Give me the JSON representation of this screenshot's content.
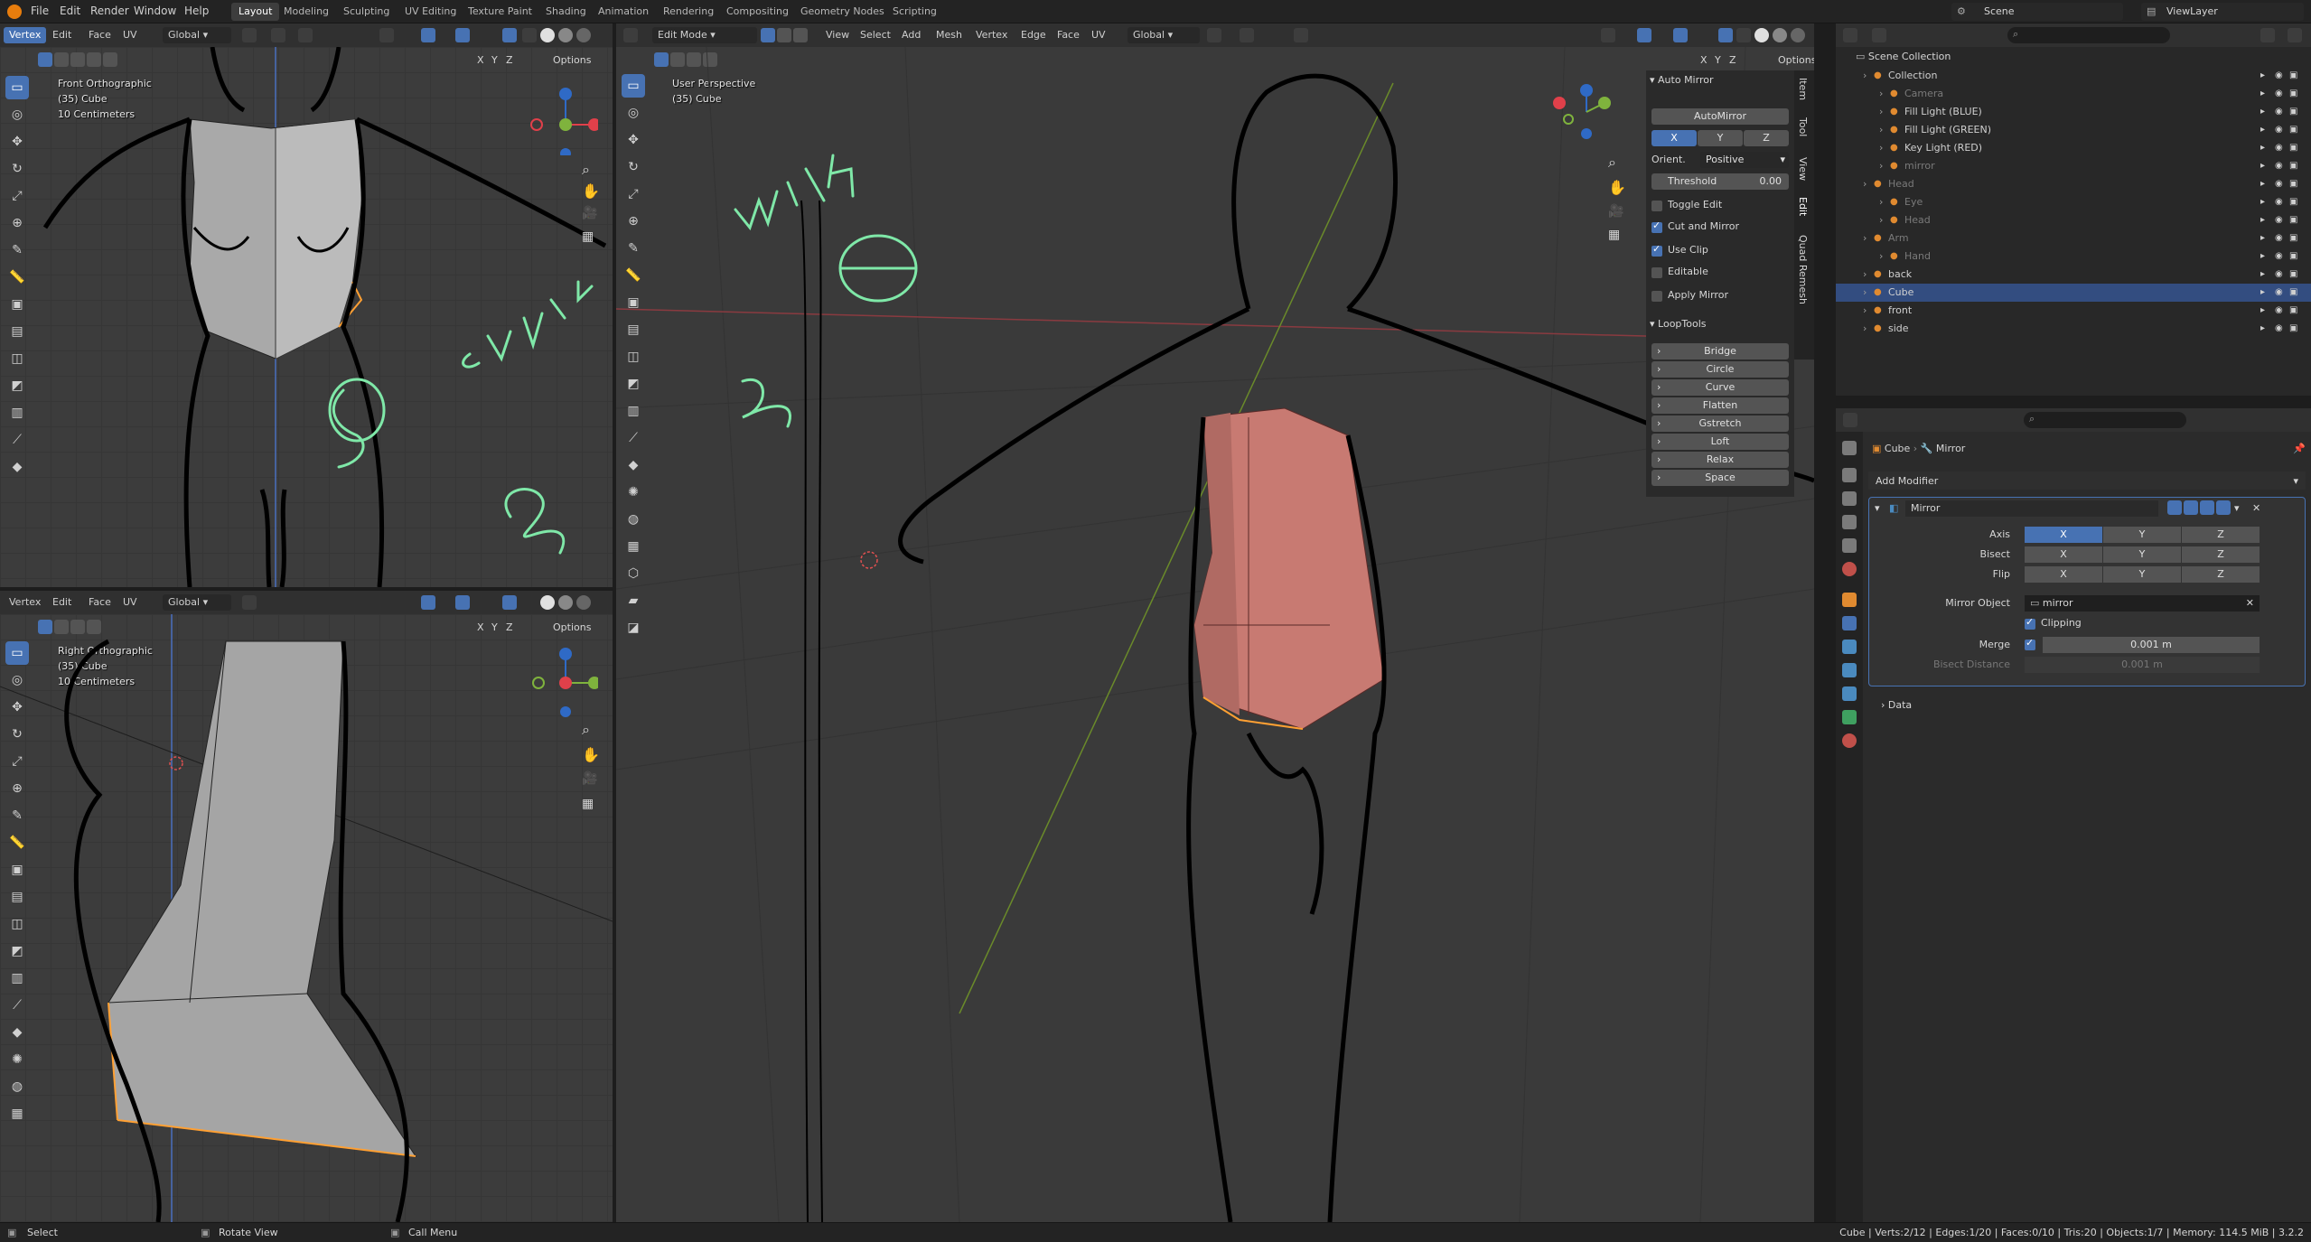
{
  "menubar": {
    "menus": [
      "File",
      "Edit",
      "Render",
      "Window",
      "Help"
    ],
    "workspaces": [
      "Layout",
      "Modeling",
      "Sculpting",
      "UV Editing",
      "Texture Paint",
      "Shading",
      "Animation",
      "Rendering",
      "Compositing",
      "Geometry Nodes",
      "Scripting"
    ],
    "active_workspace": "Layout",
    "scene_label": "Scene",
    "viewlayer_label": "ViewLayer"
  },
  "front_viewport": {
    "header": {
      "select_mode": "Vertex",
      "menus": [
        "Edit",
        "Face",
        "UV"
      ],
      "orientation": "Global",
      "options": "Options",
      "axes": [
        "X",
        "Y",
        "Z"
      ]
    },
    "overlay_title": "Front Orthographic",
    "overlay_object": "(35) Cube",
    "overlay_scale": "10 Centimeters"
  },
  "right_viewport": {
    "header": {
      "select_mode": "Vertex",
      "menus": [
        "Edit",
        "Face",
        "UV"
      ],
      "orientation": "Global",
      "options": "Options",
      "axes": [
        "X",
        "Y",
        "Z"
      ]
    },
    "overlay_title": "Right Orthographic",
    "overlay_object": "(35) Cube",
    "overlay_scale": "10 Centimeters"
  },
  "persp_viewport": {
    "header": {
      "mode": "Edit Mode",
      "menus": [
        "View",
        "Select",
        "Add",
        "Mesh",
        "Vertex",
        "Edge",
        "Face",
        "UV"
      ],
      "orientation": "Global",
      "options": "Options",
      "axes": [
        "X",
        "Y",
        "Z"
      ]
    },
    "overlay_title": "User Perspective",
    "overlay_object": "(35) Cube"
  },
  "handwriting": [
    "Corrects",
    "with",
    "Z",
    "S"
  ],
  "npanel": {
    "tabs": [
      "Item",
      "Tool",
      "View",
      "Edit",
      "Quad Remesh"
    ],
    "auto_mirror": {
      "title": "Auto Mirror",
      "button": "AutoMirror",
      "axes": [
        "X",
        "Y",
        "Z"
      ],
      "orient_label": "Orient.",
      "orient_value": "Positive",
      "threshold_label": "Threshold",
      "threshold_value": "0.00",
      "toggle_edit": "Toggle Edit",
      "cut_and_mirror": "Cut and Mirror",
      "use_clip": "Use Clip",
      "editable": "Editable",
      "apply_mirror": "Apply Mirror"
    },
    "looptools": {
      "title": "LoopTools",
      "items": [
        "Bridge",
        "Circle",
        "Curve",
        "Flatten",
        "Gstretch",
        "Loft",
        "Relax",
        "Space"
      ]
    }
  },
  "outliner": {
    "root": "Scene Collection",
    "rows": [
      {
        "label": "Collection",
        "indent": 1
      },
      {
        "label": "Camera",
        "indent": 2,
        "dim": true
      },
      {
        "label": "Fill Light (BLUE)",
        "indent": 2
      },
      {
        "label": "Fill Light (GREEN)",
        "indent": 2
      },
      {
        "label": "Key Light (RED)",
        "indent": 2
      },
      {
        "label": "mirror",
        "indent": 2,
        "dim": true
      },
      {
        "label": "Head",
        "indent": 1,
        "dim": true
      },
      {
        "label": "Eye",
        "indent": 2,
        "dim": true
      },
      {
        "label": "Head",
        "indent": 2,
        "dim": true
      },
      {
        "label": "Arm",
        "indent": 1,
        "dim": true
      },
      {
        "label": "Hand",
        "indent": 2,
        "dim": true
      },
      {
        "label": "back",
        "indent": 1
      },
      {
        "label": "Cube",
        "indent": 1,
        "selected": true
      },
      {
        "label": "front",
        "indent": 1
      },
      {
        "label": "side",
        "indent": 1
      }
    ]
  },
  "properties": {
    "breadcrumb_object": "Cube",
    "breadcrumb_modifier": "Mirror",
    "add_modifier": "Add Modifier",
    "modifier_name": "Mirror",
    "axis_label": "Axis",
    "bisect_label": "Bisect",
    "flip_label": "Flip",
    "axes": [
      "X",
      "Y",
      "Z"
    ],
    "mirror_object_label": "Mirror Object",
    "mirror_object_value": "mirror",
    "clipping_label": "Clipping",
    "merge_label": "Merge",
    "merge_value": "0.001 m",
    "bisect_distance_label": "Bisect Distance",
    "bisect_distance_value": "0.001 m",
    "data_label": "Data"
  },
  "statusbar": {
    "select": "Select",
    "rotate": "Rotate View",
    "call_menu": "Call Menu",
    "stats": "Cube | Verts:2/12 | Edges:1/20 | Faces:0/10 | Tris:20 | Objects:1/7 | Memory: 114.5 MiB | 3.2.2"
  },
  "colors": {
    "accent": "#4772b3",
    "mesh_fill": "#c87a72",
    "handwriting": "#7fe8a8",
    "select_orange": "#ffa033"
  }
}
